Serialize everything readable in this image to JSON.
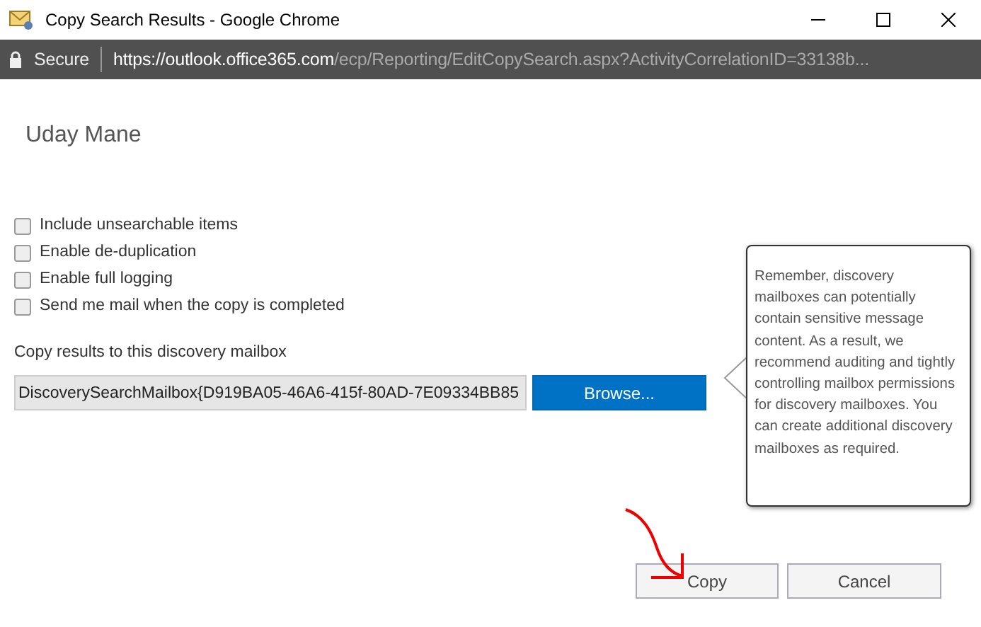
{
  "window": {
    "title": "Copy Search Results - Google Chrome"
  },
  "address_bar": {
    "security": "Secure",
    "url_host": "https://outlook.office365.com",
    "url_path": "/ecp/Reporting/EditCopySearch.aspx?ActivityCorrelationID=33138b..."
  },
  "heading": "Uday Mane",
  "options": [
    {
      "label": "Include unsearchable items",
      "checked": false
    },
    {
      "label": "Enable de-duplication",
      "checked": false
    },
    {
      "label": "Enable full logging",
      "checked": false
    },
    {
      "label": "Send me mail when the copy is completed",
      "checked": false
    }
  ],
  "mailbox": {
    "label": "Copy results to this discovery mailbox",
    "value": "DiscoverySearchMailbox{D919BA05-46A6-415f-80AD-7E09334BB85",
    "browse": "Browse..."
  },
  "tooltip": "Remember, discovery mailboxes can potentially contain sensitive message content. As a result, we recommend auditing and tightly controlling mailbox permissions for discovery mailboxes. You can create additional discovery mailboxes as required.",
  "buttons": [
    "Copy",
    "Cancel"
  ]
}
